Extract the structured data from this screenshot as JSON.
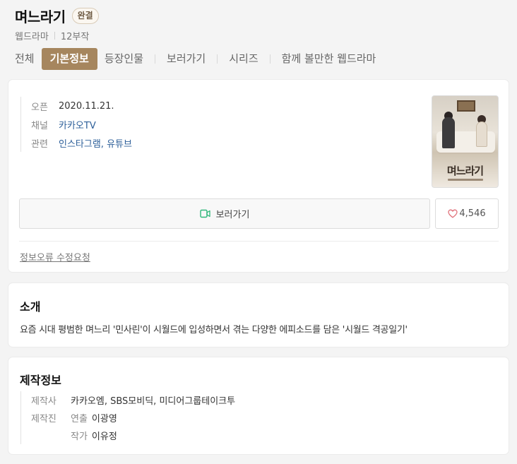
{
  "header": {
    "title": "며느라기",
    "badge": "완결",
    "genre": "웹드라마",
    "episodes": "12부작"
  },
  "tabs": [
    {
      "label": "전체",
      "active": false
    },
    {
      "label": "기본정보",
      "active": true
    },
    {
      "label": "등장인물",
      "active": false
    },
    {
      "label": "보러가기",
      "active": false
    },
    {
      "label": "시리즈",
      "active": false
    },
    {
      "label": "함께 볼만한 웹드라마",
      "active": false
    }
  ],
  "info": {
    "open_key": "오픈",
    "open_val": "2020.11.21.",
    "channel_key": "채널",
    "channel_val": "카카오TV",
    "related_key": "관련",
    "related_val": "인스타그램, 유튜브"
  },
  "poster": {
    "title_text": "며느라기"
  },
  "actions": {
    "watch_label": "보러가기",
    "like_count": "4,546"
  },
  "report_link": "정보오류 수정요청",
  "intro": {
    "title": "소개",
    "text": "요즘 시대 평범한 며느리 '민사린'이 시월드에 입성하면서 겪는 다양한 에피소드를 담은 '시월드 격공일기'"
  },
  "production": {
    "title": "제작정보",
    "company_key": "제작사",
    "company_val": "카카오엠, SBS모비딕, 미디어그룹테이크투",
    "staff_key": "제작진",
    "director_role": "연출",
    "director_name": "이광영",
    "writer_role": "작가",
    "writer_name": "이유정"
  },
  "colors": {
    "accent": "#a6865e",
    "link": "#2d5f99",
    "background": "#f4f4f4",
    "watch_icon": "#2fb67a",
    "heart_icon": "#e0707a"
  }
}
